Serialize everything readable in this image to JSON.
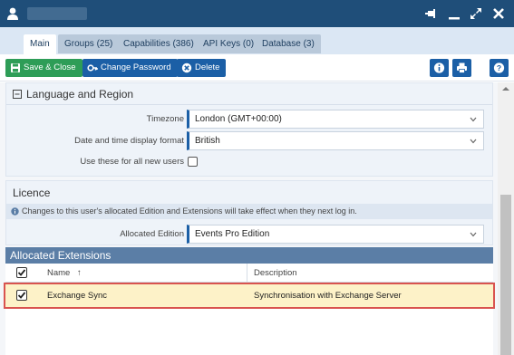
{
  "window": {
    "title_obscured": true
  },
  "tabs": [
    {
      "label": "Main",
      "active": true
    },
    {
      "label": "Groups (25)",
      "active": false
    },
    {
      "label": "Capabilities (386)",
      "active": false
    },
    {
      "label": "API Keys (0)",
      "active": false
    },
    {
      "label": "Database (3)",
      "active": false
    }
  ],
  "toolbar": {
    "save_close_label": "Save & Close",
    "change_password_label": "Change Password",
    "delete_label": "Delete"
  },
  "language_region": {
    "title": "Language and Region",
    "timezone_label": "Timezone",
    "timezone_value": "London (GMT+00:00)",
    "datetime_label": "Date and time display format",
    "datetime_value": "British",
    "all_users_label": "Use these for all new users"
  },
  "licence": {
    "title": "Licence",
    "info_text": "Changes to this user's allocated Edition and Extensions will take effect when they next log in.",
    "edition_label": "Allocated Edition",
    "edition_value": "Events Pro Edition"
  },
  "extensions": {
    "title": "Allocated Extensions",
    "col_name": "Name",
    "col_description": "Description",
    "rows": [
      {
        "name": "Exchange Sync",
        "description": "Synchronisation with Exchange Server",
        "checked": true
      }
    ]
  },
  "colors": {
    "titlebar": "#1f4e79",
    "green_button": "#2e9d57",
    "blue_button": "#1b5fa6",
    "section_header": "#5b7ea6",
    "selected_row": "#fdf2c8",
    "highlight_outline": "#d9534f"
  }
}
